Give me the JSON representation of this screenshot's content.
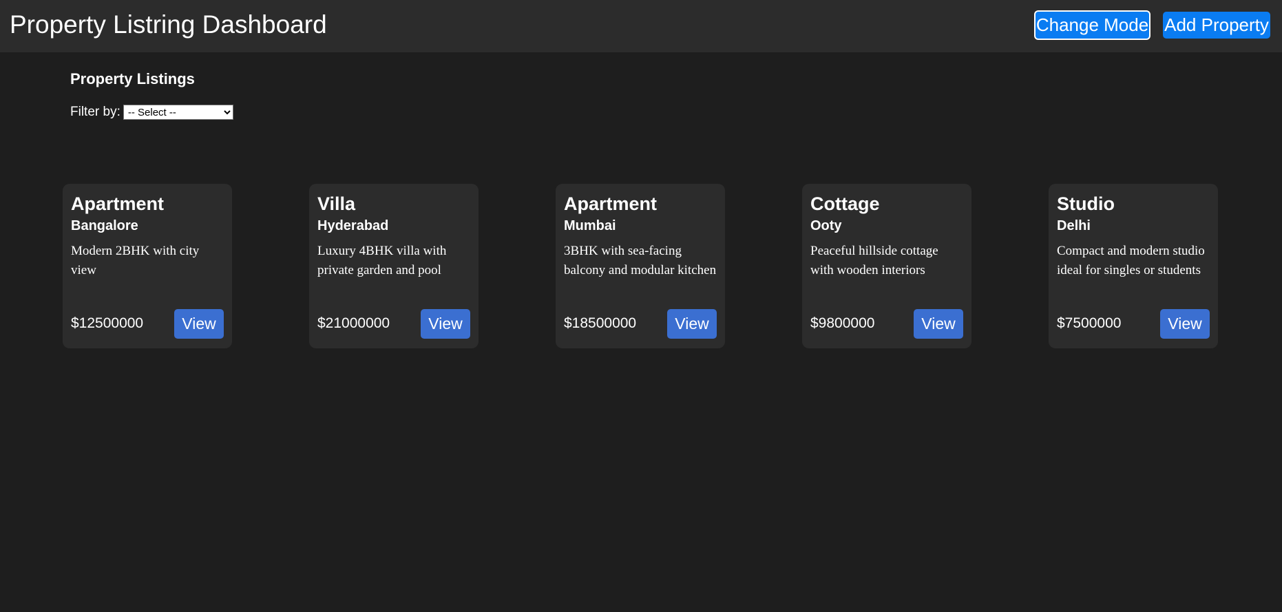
{
  "header": {
    "title": "Property Listring Dashboard",
    "change_mode_label": "Change Mode",
    "add_property_label": "Add Property"
  },
  "main": {
    "heading": "Property Listings",
    "filter": {
      "label": "Filter by:",
      "selected": "-- Select --"
    }
  },
  "listings": [
    {
      "type": "Apartment",
      "city": "Bangalore",
      "description": "Modern 2BHK with city view",
      "price": "$12500000",
      "action_label": "View"
    },
    {
      "type": "Villa",
      "city": "Hyderabad",
      "description": "Luxury 4BHK villa with private garden and pool",
      "price": "$21000000",
      "action_label": "View"
    },
    {
      "type": "Apartment",
      "city": "Mumbai",
      "description": "3BHK with sea-facing balcony and modular kitchen",
      "price": "$18500000",
      "action_label": "View"
    },
    {
      "type": "Cottage",
      "city": "Ooty",
      "description": "Peaceful hillside cottage with wooden interiors",
      "price": "$9800000",
      "action_label": "View"
    },
    {
      "type": "Studio",
      "city": "Delhi",
      "description": "Compact and modern studio ideal for singles or students",
      "price": "$7500000",
      "action_label": "View"
    }
  ],
  "colors": {
    "page_background": "#1e1e1e",
    "panel_background": "#2c2c2c",
    "header_button": "#0a7cf2",
    "view_button": "#3b6fd1",
    "text": "#ffffff"
  }
}
